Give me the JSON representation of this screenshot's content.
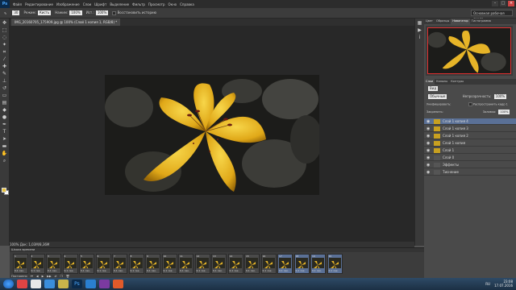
{
  "menubar": {
    "logo": "Ps",
    "items": [
      "Файл",
      "Редактирование",
      "Изображение",
      "Слои",
      "Шрифт",
      "Выделение",
      "Фильтр",
      "Просмотр",
      "Окно",
      "Справка"
    ]
  },
  "options": {
    "mode_label": "Режим:",
    "mode_value": "Кисть",
    "opacity_label": "Нажим:",
    "opacity_value": "100%",
    "flow_label": "Ист.:",
    "flow_value": "100%",
    "erase_history": "Восстановить историю",
    "workspace": "Основная рабочая среда"
  },
  "document": {
    "tab_label": "IMG_20160705_175909.jpg @ 100% (Слой 1 копия 1, RGB/8) *",
    "status": "100%      Док: 1,03M/8,36M"
  },
  "panels": {
    "top_tabs": [
      "Цвет",
      "Образцы",
      "Навигатор",
      "Гистограмма",
      "Стили",
      "Свойства",
      "Слои",
      "Каналы"
    ],
    "active_top_tab": "Навигатор",
    "layers_tabs": [
      "Слои",
      "Каналы",
      "Контуры"
    ],
    "kind_label": "Вид",
    "blend_mode": "Обычные",
    "opacity_label": "Непрозрачность:",
    "opacity_value": "100%",
    "unify_label": "Унифицировать:",
    "propagate_label": "Распространить кадр 1",
    "lock_label": "Закрепить:",
    "fill_label": "Заливка:",
    "fill_value": "100%",
    "layers": [
      {
        "name": "Слой 1 копия 4",
        "selected": true
      },
      {
        "name": "Слой 1 копия 3",
        "selected": false
      },
      {
        "name": "Слой 1 копия 2",
        "selected": false
      },
      {
        "name": "Слой 1 копия",
        "selected": false
      },
      {
        "name": "Слой 1",
        "selected": false
      },
      {
        "name": "Слой 0",
        "selected": false
      },
      {
        "name": "Эффекты",
        "selected": false
      },
      {
        "name": "Тиснение",
        "selected": false
      }
    ]
  },
  "timeline": {
    "title": "Шкала времени",
    "frames": [
      {
        "num": "1",
        "delay": "0,1 сек."
      },
      {
        "num": "2",
        "delay": "0,1 сек."
      },
      {
        "num": "3",
        "delay": "0,1 сек."
      },
      {
        "num": "4",
        "delay": "0,1 сек."
      },
      {
        "num": "5",
        "delay": "0,1 сек."
      },
      {
        "num": "6",
        "delay": "0,1 сек."
      },
      {
        "num": "7",
        "delay": "0,1 сек."
      },
      {
        "num": "8",
        "delay": "0,1 сек."
      },
      {
        "num": "9",
        "delay": "0,1 сек."
      },
      {
        "num": "10",
        "delay": "0,1 сек."
      },
      {
        "num": "11",
        "delay": "0,1 сек."
      },
      {
        "num": "12",
        "delay": "0,1 сек."
      },
      {
        "num": "13",
        "delay": "0,1 сек."
      },
      {
        "num": "14",
        "delay": "0,1 сек."
      },
      {
        "num": "15",
        "delay": "0,1 сек."
      },
      {
        "num": "16",
        "delay": "0,1 сек."
      },
      {
        "num": "17",
        "delay": "0,1 сек."
      },
      {
        "num": "18",
        "delay": "0,1 сек."
      },
      {
        "num": "19",
        "delay": "0,1 сек."
      },
      {
        "num": "20",
        "delay": "0,1 сек."
      }
    ],
    "loop": "Постоянно"
  },
  "taskbar": {
    "time": "23:08",
    "date": "17.07.2016",
    "lang": "RU"
  }
}
